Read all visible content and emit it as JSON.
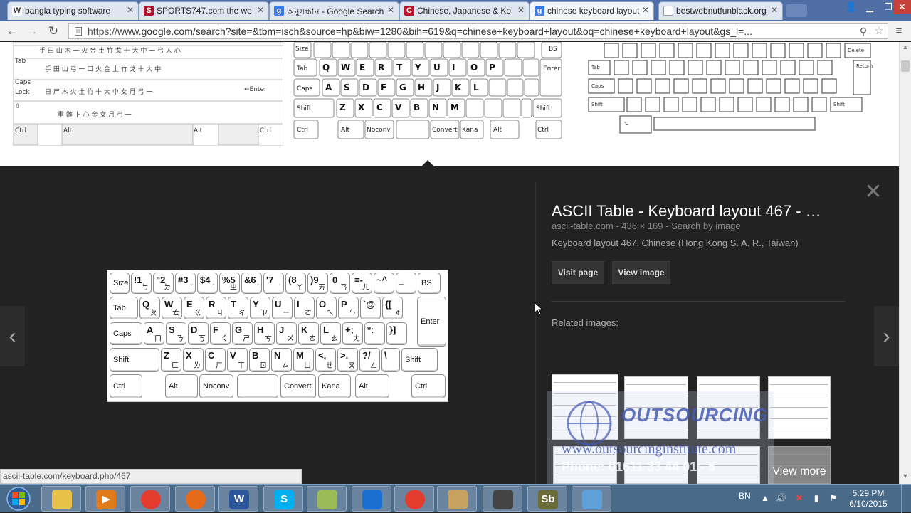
{
  "tabs": [
    {
      "label": "bangla typing software",
      "favicon": "W"
    },
    {
      "label": "SPORTS747.com the we",
      "favicon": "S"
    },
    {
      "label": "অনুসন্ধান - Google Search",
      "favicon": "g"
    },
    {
      "label": "Chinese, Japanese & Ko",
      "favicon": "C"
    },
    {
      "label": "chinese keyboard layout",
      "favicon": "g"
    },
    {
      "label": "bestwebnutfunblack.org",
      "favicon": ""
    }
  ],
  "omnibox": {
    "scheme": "https://",
    "rest": "www.google.com/search?site=&tbm=isch&source=hp&biw=1280&bih=619&q=chinese+keyboard+layout&oq=chinese+keyboard+layout&gs_l=..."
  },
  "preview": {
    "title": "ASCII Table - Keyboard layout 467 - …",
    "site": "ascii-table.com",
    "dimensions": "436 × 169",
    "search_by_image": "Search by image",
    "description": "Keyboard layout 467. Chinese (Hong Kong S. A. R., Taiwan)",
    "visit_page": "Visit page",
    "view_image": "View image",
    "related_label": "Related images:",
    "view_more": "View more"
  },
  "keyboard": {
    "row1": [
      {
        "main": "Size",
        "sub": ""
      },
      {
        "main": "!1",
        "sub": "ㄅ"
      },
      {
        "main": "\"2",
        "sub": "ㄉ"
      },
      {
        "main": "#3",
        "sub": "ˇ"
      },
      {
        "main": "$4",
        "sub": "ˋ"
      },
      {
        "main": "%5",
        "sub": "ㄓ"
      },
      {
        "main": "&6",
        "sub": "ˊ"
      },
      {
        "main": "'7",
        "sub": "˙"
      },
      {
        "main": "(8",
        "sub": "ㄚ"
      },
      {
        "main": ")9",
        "sub": "ㄞ"
      },
      {
        "main": "0",
        "sub": "ㄢ"
      },
      {
        "main": "=-",
        "sub": "ㄦ"
      },
      {
        "main": "~^",
        "sub": ""
      },
      {
        "main": "_",
        "sub": ""
      },
      {
        "main": "BS",
        "sub": ""
      }
    ],
    "row2": [
      {
        "main": "Tab",
        "sub": ""
      },
      {
        "main": "Q",
        "sub": "ㄆ"
      },
      {
        "main": "W",
        "sub": "ㄊ"
      },
      {
        "main": "E",
        "sub": "ㄍ"
      },
      {
        "main": "R",
        "sub": "ㄐ"
      },
      {
        "main": "T",
        "sub": "ㄔ"
      },
      {
        "main": "Y",
        "sub": "ㄗ"
      },
      {
        "main": "U",
        "sub": "ㄧ"
      },
      {
        "main": "I",
        "sub": "ㄛ"
      },
      {
        "main": "O",
        "sub": "ㄟ"
      },
      {
        "main": "P",
        "sub": "ㄣ"
      },
      {
        "main": "`@",
        "sub": ""
      },
      {
        "main": "{[",
        "sub": "¢"
      }
    ],
    "row3": [
      {
        "main": "Caps",
        "sub": ""
      },
      {
        "main": "A",
        "sub": "ㄇ"
      },
      {
        "main": "S",
        "sub": "ㄋ"
      },
      {
        "main": "D",
        "sub": "ㄎ"
      },
      {
        "main": "F",
        "sub": "ㄑ"
      },
      {
        "main": "G",
        "sub": "ㄕ"
      },
      {
        "main": "H",
        "sub": "ㄘ"
      },
      {
        "main": "J",
        "sub": "ㄨ"
      },
      {
        "main": "K",
        "sub": "ㄜ"
      },
      {
        "main": "L",
        "sub": "ㄠ"
      },
      {
        "main": "+;",
        "sub": "ㄤ"
      },
      {
        "main": "*:",
        "sub": ""
      },
      {
        "main": "}]",
        "sub": ""
      }
    ],
    "row4": [
      {
        "main": "Shift",
        "sub": ""
      },
      {
        "main": "Z",
        "sub": "ㄈ"
      },
      {
        "main": "X",
        "sub": "ㄌ"
      },
      {
        "main": "C",
        "sub": "ㄏ"
      },
      {
        "main": "V",
        "sub": "ㄒ"
      },
      {
        "main": "B",
        "sub": "ㄖ"
      },
      {
        "main": "N",
        "sub": "ㄙ"
      },
      {
        "main": "M",
        "sub": "ㄩ"
      },
      {
        "main": "<,",
        "sub": "ㄝ"
      },
      {
        "main": ">.",
        "sub": "ㄡ"
      },
      {
        "main": "?/",
        "sub": "ㄥ"
      },
      {
        "main": "\\",
        "sub": ""
      },
      {
        "main": "Shift",
        "sub": ""
      }
    ],
    "row5": [
      "Ctrl",
      "Alt",
      "Noconv",
      "",
      "Convert",
      "Kana",
      "Alt",
      "Ctrl"
    ],
    "enter": "Enter"
  },
  "status_url": "ascii-table.com/keyboard.php/467",
  "watermark": {
    "line1": "OUTSOURCING",
    "line2": "www.outsourcinginstitute.com",
    "line3": "Phone: 01611 33 44 01 - 5"
  },
  "taskbar": {
    "lang": "BN",
    "time": "5:29 PM",
    "date": "6/10/2015",
    "apps": [
      {
        "name": "file-explorer",
        "label": "",
        "color": "#e8c14a"
      },
      {
        "name": "media-player",
        "label": "▶",
        "color": "#e07a1a"
      },
      {
        "name": "chrome",
        "label": "",
        "color": "#e33b2e"
      },
      {
        "name": "firefox",
        "label": "",
        "color": "#e66a1a"
      },
      {
        "name": "word",
        "label": "W",
        "color": "#2b579a"
      },
      {
        "name": "skype",
        "label": "S",
        "color": "#00aff0"
      },
      {
        "name": "archive",
        "label": "",
        "color": "#9bbb59"
      },
      {
        "name": "teamviewer",
        "label": "",
        "color": "#1a6fd1"
      },
      {
        "name": "chrome-2",
        "label": "",
        "color": "#e33b2e"
      },
      {
        "name": "paint",
        "label": "",
        "color": "#c8a060"
      },
      {
        "name": "camera",
        "label": "",
        "color": "#444"
      },
      {
        "name": "sb-app",
        "label": "Sb",
        "color": "#6b6b3a"
      },
      {
        "name": "screen-app",
        "label": "",
        "color": "#5fa0d8"
      }
    ]
  },
  "colors": {
    "tabbar": "#4f6ea6",
    "preview_bg": "#222222",
    "taskbar": "#4a6a8a"
  }
}
